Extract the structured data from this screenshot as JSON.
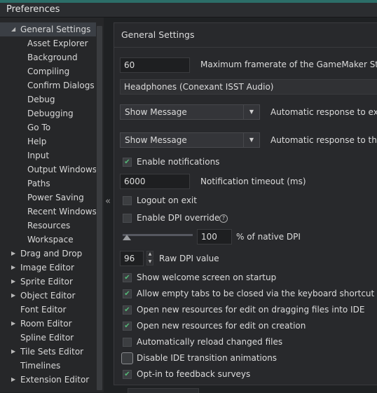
{
  "window": {
    "title": "Preferences"
  },
  "tree": {
    "items": [
      {
        "label": "General Settings",
        "indent": 0,
        "arrow": "down"
      },
      {
        "label": "Asset Explorer",
        "indent": 1,
        "arrow": ""
      },
      {
        "label": "Background",
        "indent": 1,
        "arrow": ""
      },
      {
        "label": "Compiling",
        "indent": 1,
        "arrow": ""
      },
      {
        "label": "Confirm Dialogs",
        "indent": 1,
        "arrow": ""
      },
      {
        "label": "Debug",
        "indent": 1,
        "arrow": ""
      },
      {
        "label": "Debugging",
        "indent": 1,
        "arrow": ""
      },
      {
        "label": "Go To",
        "indent": 1,
        "arrow": ""
      },
      {
        "label": "Help",
        "indent": 1,
        "arrow": ""
      },
      {
        "label": "Input",
        "indent": 1,
        "arrow": ""
      },
      {
        "label": "Output Windows",
        "indent": 1,
        "arrow": ""
      },
      {
        "label": "Paths",
        "indent": 1,
        "arrow": ""
      },
      {
        "label": "Power Saving",
        "indent": 1,
        "arrow": ""
      },
      {
        "label": "Recent Windows",
        "indent": 1,
        "arrow": ""
      },
      {
        "label": "Resources",
        "indent": 1,
        "arrow": ""
      },
      {
        "label": "Workspace",
        "indent": 1,
        "arrow": ""
      },
      {
        "label": "Drag and Drop",
        "indent": 0,
        "arrow": "right"
      },
      {
        "label": "Image Editor",
        "indent": 0,
        "arrow": "right"
      },
      {
        "label": "Sprite Editor",
        "indent": 0,
        "arrow": "right"
      },
      {
        "label": "Object Editor",
        "indent": 0,
        "arrow": "right"
      },
      {
        "label": "Font Editor",
        "indent": 0,
        "arrow": ""
      },
      {
        "label": "Room Editor",
        "indent": 0,
        "arrow": "right"
      },
      {
        "label": "Spline Editor",
        "indent": 0,
        "arrow": ""
      },
      {
        "label": "Tile Sets Editor",
        "indent": 0,
        "arrow": "right"
      },
      {
        "label": "Timelines",
        "indent": 0,
        "arrow": ""
      },
      {
        "label": "Extension Editor",
        "indent": 0,
        "arrow": "right"
      }
    ]
  },
  "splitter": {
    "icon": "collapse-left-icon",
    "glyph": "«"
  },
  "panel": {
    "title": "General Settings",
    "framerate": {
      "value": "60",
      "label": "Maximum framerate of the GameMaker Studio"
    },
    "audio_device": {
      "value": "Headphones (Conexant ISST Audio)"
    },
    "exit_response": {
      "value": "Show Message",
      "label": "Automatic response to exit"
    },
    "second_response": {
      "value": "Show Message",
      "label": "Automatic response to the s"
    },
    "enable_notifications": {
      "label": "Enable notifications",
      "checked": true
    },
    "notification_timeout": {
      "value": "6000",
      "label": "Notification timeout (ms)"
    },
    "logout_on_exit": {
      "label": "Logout on exit",
      "checked": false
    },
    "dpi_override": {
      "label": "Enable DPI override",
      "checked": false
    },
    "native_dpi": {
      "value": "100",
      "label": "% of native DPI",
      "level_percent": 0
    },
    "raw_dpi": {
      "value": "96",
      "label": "Raw DPI value"
    },
    "checkboxes": [
      {
        "label": "Show welcome screen on startup",
        "checked": true
      },
      {
        "label": "Allow empty tabs to be closed via the keyboard shortcut",
        "checked": true
      },
      {
        "label": "Open new resources for edit on dragging files into IDE",
        "checked": true
      },
      {
        "label": "Open new resources for edit on creation",
        "checked": true
      },
      {
        "label": "Automatically reload changed files",
        "checked": false
      },
      {
        "label": "Disable IDE transition animations",
        "checked": false
      },
      {
        "label": "Opt-in to feedback surveys",
        "checked": true
      }
    ]
  },
  "colors": {
    "accent": "#2c6e68",
    "check": "#55b878",
    "selected_row": "#3b3f45"
  }
}
